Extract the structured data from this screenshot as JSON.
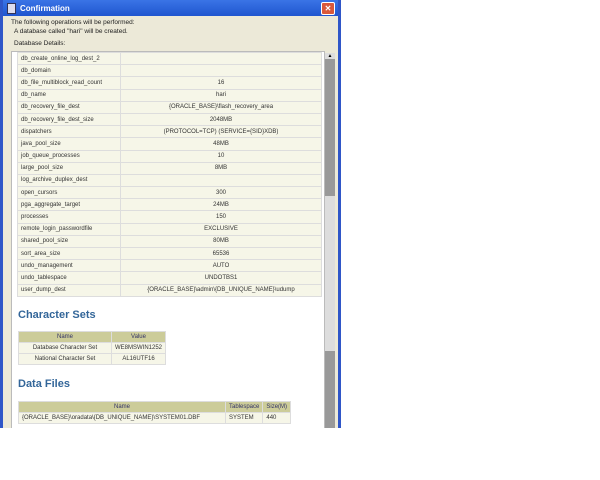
{
  "window": {
    "title": "Confirmation"
  },
  "messages": {
    "line1": "The following operations will be performed:",
    "line2": "A database called \"hari\" will be created.",
    "details_label": "Database Details:"
  },
  "params": [
    {
      "name": "db_create_online_log_dest_2",
      "value": ""
    },
    {
      "name": "db_domain",
      "value": ""
    },
    {
      "name": "db_file_multiblock_read_count",
      "value": "16"
    },
    {
      "name": "db_name",
      "value": "hari"
    },
    {
      "name": "db_recovery_file_dest",
      "value": "{ORACLE_BASE}\\flash_recovery_area"
    },
    {
      "name": "db_recovery_file_dest_size",
      "value": "2048MB"
    },
    {
      "name": "dispatchers",
      "value": "(PROTOCOL=TCP) (SERVICE={SID}XDB)"
    },
    {
      "name": "java_pool_size",
      "value": "48MB"
    },
    {
      "name": "job_queue_processes",
      "value": "10"
    },
    {
      "name": "large_pool_size",
      "value": "8MB"
    },
    {
      "name": "log_archive_duplex_dest",
      "value": ""
    },
    {
      "name": "open_cursors",
      "value": "300"
    },
    {
      "name": "pga_aggregate_target",
      "value": "24MB"
    },
    {
      "name": "processes",
      "value": "150"
    },
    {
      "name": "remote_login_passwordfile",
      "value": "EXCLUSIVE"
    },
    {
      "name": "shared_pool_size",
      "value": "80MB"
    },
    {
      "name": "sort_area_size",
      "value": "65536"
    },
    {
      "name": "undo_management",
      "value": "AUTO"
    },
    {
      "name": "undo_tablespace",
      "value": "UNDOTBS1"
    },
    {
      "name": "user_dump_dest",
      "value": "{ORACLE_BASE}\\admin\\{DB_UNIQUE_NAME}\\udump"
    }
  ],
  "charsets": {
    "title": "Character Sets",
    "headers": [
      "Name",
      "Value"
    ],
    "rows": [
      [
        "Database Character Set",
        "WE8MSWIN1252"
      ],
      [
        "National Character Set",
        "AL16UTF16"
      ]
    ]
  },
  "datafiles": {
    "title": "Data Files",
    "headers": [
      "Name",
      "Tablespace",
      "Size(M)"
    ],
    "rows": [
      [
        "{ORACLE_BASE}\\oradata\\{DB_UNIQUE_NAME}\\SYSTEM01.DBF",
        "SYSTEM",
        "440"
      ]
    ]
  }
}
